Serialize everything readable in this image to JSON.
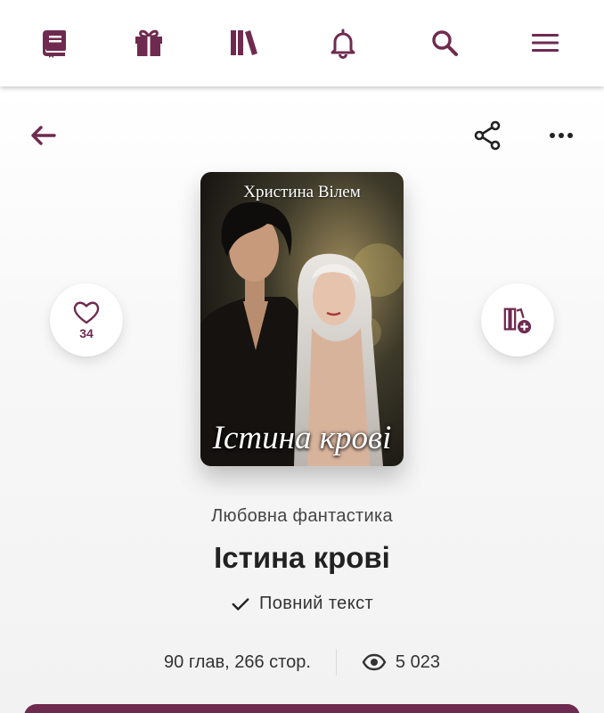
{
  "colors": {
    "accent": "#6f2b4f",
    "text": "#222222"
  },
  "topbar": {
    "icons": [
      "book-icon",
      "gift-icon",
      "library-icon",
      "bell-icon",
      "search-icon",
      "menu-icon"
    ]
  },
  "toolbar": {
    "icons": [
      "back-arrow-icon",
      "share-icon",
      "more-icon"
    ]
  },
  "actions": {
    "like_count": "34",
    "add_to_library_icon": "library-add-icon"
  },
  "cover": {
    "author": "Христина Вілем",
    "title": "Істина крові"
  },
  "book": {
    "genre": "Любовна фантастика",
    "title": "Істина крові",
    "status": "Повний текст",
    "chapters_pages": "90 глав, 266 стор.",
    "views": "5 023"
  }
}
